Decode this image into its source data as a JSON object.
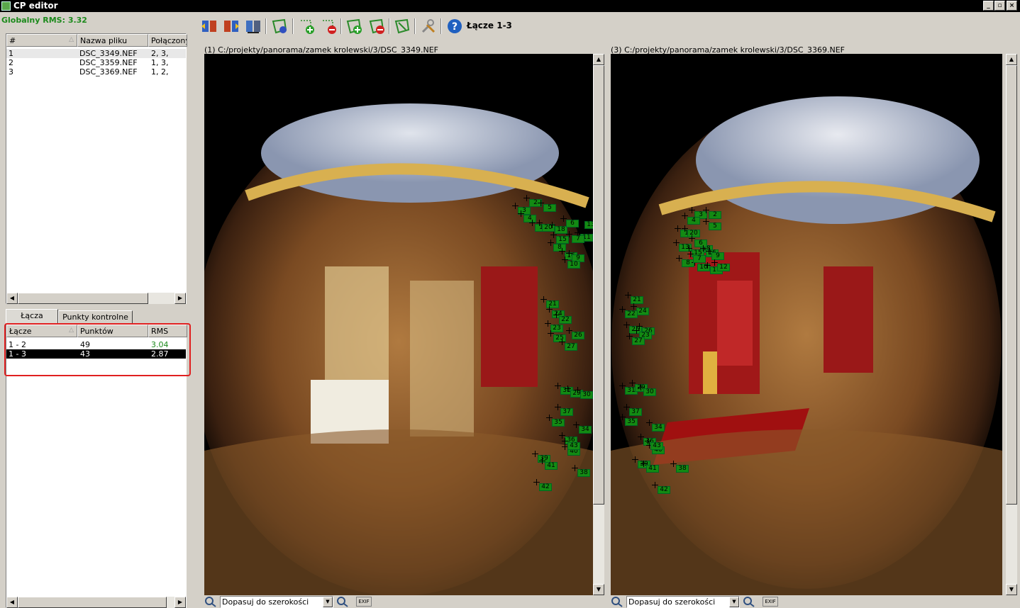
{
  "window": {
    "title": "CP editor",
    "controls": [
      "_",
      "▫",
      "×"
    ]
  },
  "global_rms": "Globalny RMS: 3.32",
  "files": {
    "columns": [
      "#",
      "Nazwa pliku",
      "Połączony"
    ],
    "rows": [
      {
        "num": "1",
        "name": "DSC_3349.NEF",
        "linked": "2, 3,"
      },
      {
        "num": "2",
        "name": "DSC_3359.NEF",
        "linked": "1, 3,"
      },
      {
        "num": "3",
        "name": "DSC_3369.NEF",
        "linked": "1, 2,"
      }
    ]
  },
  "tabs": [
    {
      "label": "Łącza"
    },
    {
      "label": "Punkty kontrolne"
    }
  ],
  "links": {
    "columns": [
      "Łącze",
      "Punktów",
      "RMS"
    ],
    "rows": [
      {
        "link": "1 - 2",
        "points": "49",
        "rms": "3.04",
        "rms_color": "#1c8a1c",
        "selected": false
      },
      {
        "link": "1 - 3",
        "points": "43",
        "rms": "2.87",
        "rms_color": "#ffffff",
        "selected": true
      }
    ]
  },
  "toolbar": {
    "link_label": "Łącze 1-3",
    "icons": [
      "prev-link-icon",
      "next-link-icon",
      "swap-images-icon",
      "auto-find-icon",
      "add-point-icon",
      "remove-point-icon",
      "add-link-icon",
      "remove-link-icon",
      "optimize-icon",
      "settings-icon",
      "help-icon"
    ]
  },
  "left_image": {
    "path": "(1) C:/projekty/panorama/zamek krolewski/3/DSC_3349.NEF",
    "zoom": "Dopasuj do szerokości",
    "exif": "EXIF",
    "points": [
      "2",
      "3",
      "5",
      "4",
      "1",
      "20",
      "18",
      "6",
      "11",
      "13",
      "15",
      "8",
      "16",
      "9",
      "10",
      "7",
      "21",
      "24",
      "22",
      "23",
      "25",
      "26",
      "27",
      "31",
      "29",
      "30",
      "37",
      "35",
      "34",
      "36",
      "40",
      "43",
      "39",
      "41",
      "38",
      "42"
    ]
  },
  "right_image": {
    "path": "(3) C:/projekty/panorama/zamek krolewski/3/DSC_3369.NEF",
    "zoom": "Dopasuj do szerokości",
    "exif": "EXIF",
    "points": [
      "3",
      "2",
      "4",
      "5",
      "1",
      "20",
      "18",
      "6",
      "13",
      "15",
      "8",
      "16",
      "9",
      "10",
      "11",
      "7",
      "12",
      "21",
      "24",
      "22",
      "25",
      "26",
      "23",
      "27",
      "31",
      "29",
      "30",
      "37",
      "35",
      "34",
      "36",
      "40",
      "43",
      "39",
      "41",
      "38",
      "42"
    ]
  },
  "colors": {
    "point_fill": "#138a13",
    "rms_highlight": "#1c8a1c",
    "selection": "#000000"
  }
}
